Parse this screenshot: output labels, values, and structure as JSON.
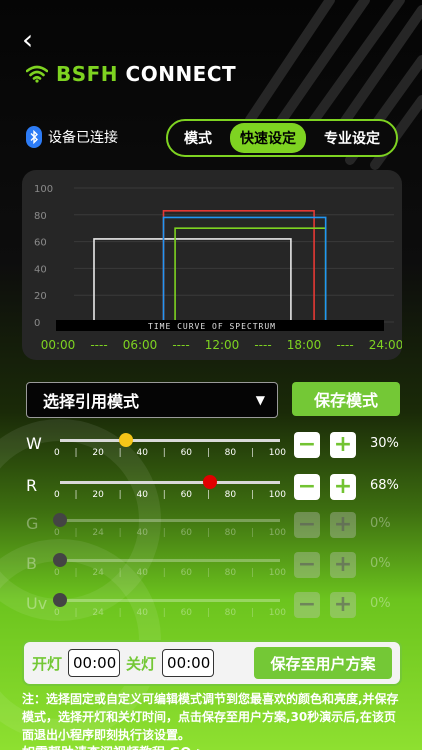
{
  "header": {
    "back_glyph": "‹",
    "brand_bsfh": "BSFH",
    "brand_connect": " CONNECT"
  },
  "bluetooth": {
    "icon": "bluetooth-icon",
    "status": "设备已连接",
    "color": "#2d7cf6"
  },
  "mode_tabs": [
    {
      "label": "模式",
      "active": false
    },
    {
      "label": "快速设定",
      "active": true
    },
    {
      "label": "专业设定",
      "active": false
    }
  ],
  "chart_data": {
    "type": "line",
    "title": "TIME CURVE OF SPECTRUM",
    "y_ticks": [
      "100",
      "80",
      "60",
      "40",
      "20",
      "0"
    ],
    "x_ticks": [
      "00:00",
      "----",
      "06:00",
      "----",
      "12:00",
      "----",
      "18:00",
      "----",
      "24:00"
    ],
    "ylim": [
      0,
      100
    ],
    "xlim": [
      0,
      24
    ],
    "series": [
      {
        "color": "#e8e8e8",
        "points": [
          [
            0,
            0
          ],
          [
            0,
            62
          ],
          [
            17,
            62
          ],
          [
            17,
            0
          ]
        ]
      },
      {
        "color": "#e53935",
        "points": [
          [
            6,
            0
          ],
          [
            6,
            83
          ],
          [
            19,
            83
          ],
          [
            19,
            0
          ]
        ]
      },
      {
        "color": "#7ed321",
        "points": [
          [
            7,
            0
          ],
          [
            7,
            70
          ],
          [
            20,
            70
          ],
          [
            20,
            0
          ]
        ]
      },
      {
        "color": "#2196f3",
        "points": [
          [
            6,
            0
          ],
          [
            6,
            78
          ],
          [
            20,
            78
          ],
          [
            20,
            0
          ]
        ]
      }
    ]
  },
  "mode_select": {
    "value": "选择引用模式",
    "arrow": "▼"
  },
  "save_mode_label": "保存模式",
  "channels": [
    {
      "label": "W",
      "ticks": [
        "0",
        "20",
        "40",
        "60",
        "80",
        "100"
      ],
      "value": 30,
      "pct": "30%",
      "knob_color": "#f5c518",
      "enabled": true
    },
    {
      "label": "R",
      "ticks": [
        "0",
        "20",
        "40",
        "60",
        "80",
        "100"
      ],
      "value": 68,
      "pct": "68%",
      "knob_color": "#e00000",
      "enabled": true
    },
    {
      "label": "G",
      "ticks": [
        "0",
        "24",
        "40",
        "60",
        "80",
        "100"
      ],
      "value": 0,
      "pct": "0%",
      "knob_color": "#444444",
      "enabled": false
    },
    {
      "label": "B",
      "ticks": [
        "0",
        "24",
        "40",
        "60",
        "80",
        "100"
      ],
      "value": 0,
      "pct": "0%",
      "knob_color": "#444444",
      "enabled": false
    },
    {
      "label": "Uv",
      "ticks": [
        "0",
        "24",
        "40",
        "60",
        "80",
        "100"
      ],
      "value": 0,
      "pct": "0%",
      "knob_color": "#444444",
      "enabled": false
    }
  ],
  "minus_glyph": "−",
  "plus_glyph": "+",
  "schedule": {
    "on_label": "开灯",
    "on_time": "00:00",
    "off_label": "关灯",
    "off_time": "00:00",
    "save_user_label": "保存至用户方案"
  },
  "note": "注：选择固定或自定义可编辑模式调节到您最喜欢的颜色和亮度,并保存模式，选择开灯和关灯时间，点击保存至用户方案,30秒演示后,在该页面退出小程序即刻执行该设置。",
  "help": "如需帮助请查阅视频教程 GO >"
}
